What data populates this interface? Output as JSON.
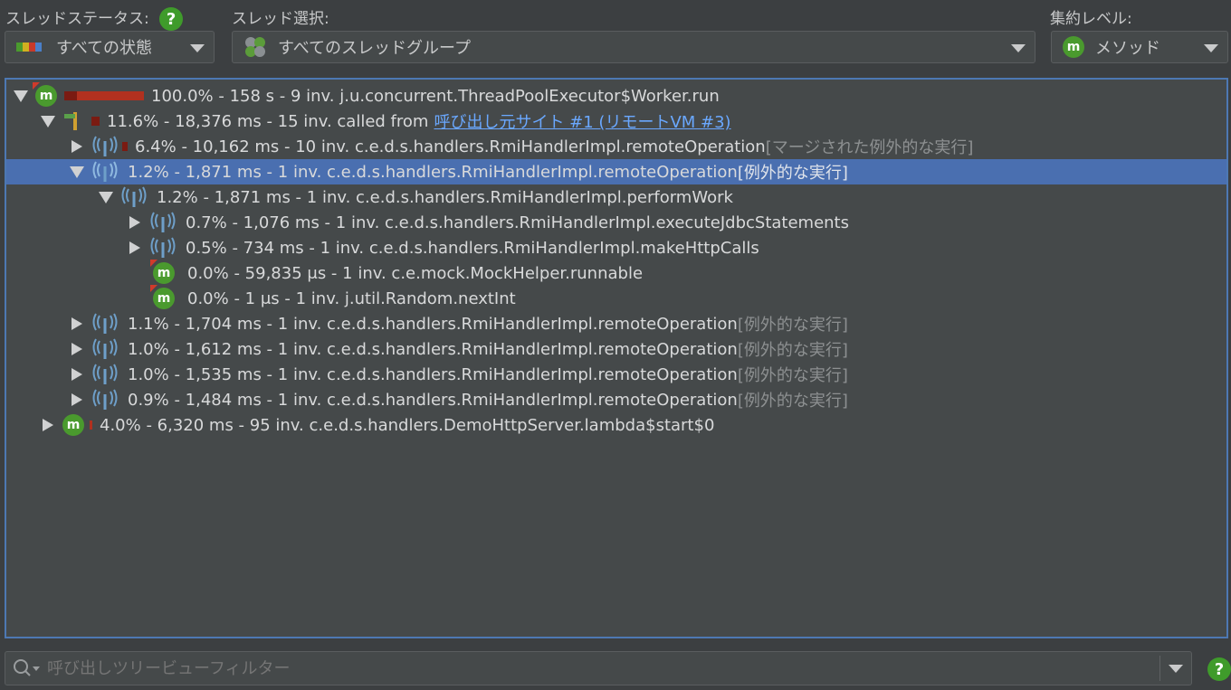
{
  "toolbar": {
    "thread_status_label": "スレッドステータス:",
    "thread_status_value": "すべての状態",
    "thread_select_label": "スレッド選択:",
    "thread_select_value": "すべてのスレッドグループ",
    "aggregation_label": "集約レベル:",
    "aggregation_value": "メソッド",
    "help_glyph": "?"
  },
  "tree": {
    "rows": [
      {
        "text": "100.0% - 158 s - 9 inv. j.u.concurrent.ThreadPoolExecutor$Worker.run",
        "icon": "method-icon"
      },
      {
        "text": "11.6% - 18,376 ms - 15 inv. called from ",
        "link": "呼び出し元サイト #1 (リモートVM #3)",
        "icon": "flag-icon"
      },
      {
        "text": "6.4% - 10,162 ms - 10 inv. c.e.d.s.handlers.RmiHandlerImpl.remoteOperation ",
        "tag": "[マージされた例外的な実行]",
        "icon": "antenna-icon"
      },
      {
        "text": "1.2% - 1,871 ms - 1 inv. c.e.d.s.handlers.RmiHandlerImpl.remoteOperation ",
        "tag": "[例外的な実行]",
        "icon": "antenna-icon",
        "selected": true
      },
      {
        "text": "1.2% - 1,871 ms - 1 inv. c.e.d.s.handlers.RmiHandlerImpl.performWork",
        "icon": "antenna-icon"
      },
      {
        "text": "0.7% - 1,076 ms - 1 inv. c.e.d.s.handlers.RmiHandlerImpl.executeJdbcStatements",
        "icon": "antenna-icon"
      },
      {
        "text": "0.5% - 734 ms - 1 inv. c.e.d.s.handlers.RmiHandlerImpl.makeHttpCalls",
        "icon": "antenna-icon"
      },
      {
        "text": "0.0% - 59,835 μs - 1 inv. c.e.mock.MockHelper.runnable",
        "icon": "method-icon"
      },
      {
        "text": "0.0% - 1 μs - 1 inv. j.util.Random.nextInt",
        "icon": "method-icon"
      },
      {
        "text": "1.1% - 1,704 ms - 1 inv. c.e.d.s.handlers.RmiHandlerImpl.remoteOperation ",
        "tag": "[例外的な実行]",
        "icon": "antenna-icon"
      },
      {
        "text": "1.0% - 1,612 ms - 1 inv. c.e.d.s.handlers.RmiHandlerImpl.remoteOperation ",
        "tag": "[例外的な実行]",
        "icon": "antenna-icon"
      },
      {
        "text": "1.0% - 1,535 ms - 1 inv. c.e.d.s.handlers.RmiHandlerImpl.remoteOperation ",
        "tag": "[例外的な実行]",
        "icon": "antenna-icon"
      },
      {
        "text": "0.9% - 1,484 ms - 1 inv. c.e.d.s.handlers.RmiHandlerImpl.remoteOperation ",
        "tag": "[例外的な実行]",
        "icon": "antenna-icon"
      },
      {
        "text": "4.0% - 6,320 ms - 95 inv. c.e.d.s.handlers.DemoHttpServer.lambda$start$0",
        "icon": "method-icon"
      }
    ],
    "method_glyph": "m"
  },
  "filter": {
    "placeholder": "呼び出しツリービューフィルター"
  },
  "colors": {
    "background": "#3c3f41",
    "tree_background": "#45494a",
    "selection": "#4a6fb0",
    "method_icon": "#4a9a2e",
    "link": "#6aa8ff",
    "bar": "#b1311f"
  }
}
